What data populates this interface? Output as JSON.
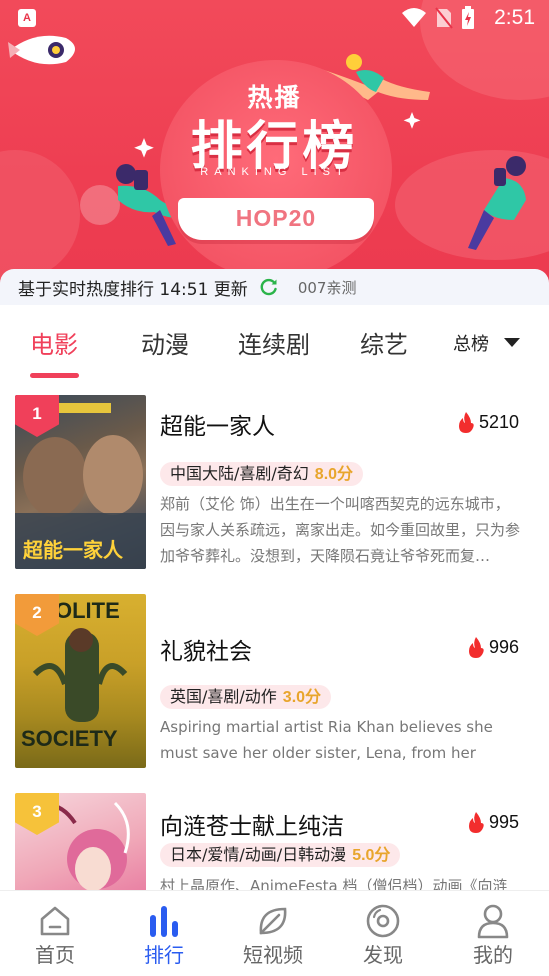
{
  "status_bar": {
    "time": "2:51",
    "app_icon": "A"
  },
  "banner": {
    "hot_label": "热播",
    "title": "排行榜",
    "subtitle": "RANKING LIST",
    "ribbon": "HOP20",
    "accent": "#f0405a"
  },
  "update": {
    "text": "基于实时热度排行 14:51 更新",
    "tag": "007亲测"
  },
  "tabs": [
    {
      "label": "电影",
      "active": true
    },
    {
      "label": "动漫",
      "active": false
    },
    {
      "label": "连续剧",
      "active": false
    },
    {
      "label": "综艺",
      "active": false
    }
  ],
  "total_label": "总榜",
  "items": [
    {
      "rank": "1",
      "title": "超能一家人",
      "hot": "5210",
      "tag": "中国大陆/喜剧/奇幻",
      "score": "8.0分",
      "desc": "郑前（艾伦 饰）出生在一个叫喀西契克的远东城市，因与家人关系疏远，离家出走。如今重回故里，只为参加爷爷葬礼。没想到，天降陨石竟让爷爷死而复…",
      "poster_text": "超能一家人"
    },
    {
      "rank": "2",
      "title": "礼貌社会",
      "hot": "996",
      "tag": "英国/喜剧/动作",
      "score": "3.0分",
      "desc": "Aspiring martial artist Ria Khan believes she must save her older sister, Lena, from her impending m",
      "poster_text": "POLITE SOCIETY"
    },
    {
      "rank": "3",
      "title": "向涟苍士献上纯洁",
      "hot": "995",
      "tag": "日本/爱情/动画/日韩动漫",
      "score": "5.0分",
      "desc": "村上晶原作、AnimeFesta 档（僧侣档）动画《向涟",
      "poster_text": ""
    }
  ],
  "nav": [
    {
      "label": "首页",
      "icon": "home-icon",
      "active": false
    },
    {
      "label": "排行",
      "icon": "ranking-icon",
      "active": true
    },
    {
      "label": "短视频",
      "icon": "leaf-icon",
      "active": false
    },
    {
      "label": "发现",
      "icon": "disc-icon",
      "active": false
    },
    {
      "label": "我的",
      "icon": "user-icon",
      "active": false
    }
  ]
}
